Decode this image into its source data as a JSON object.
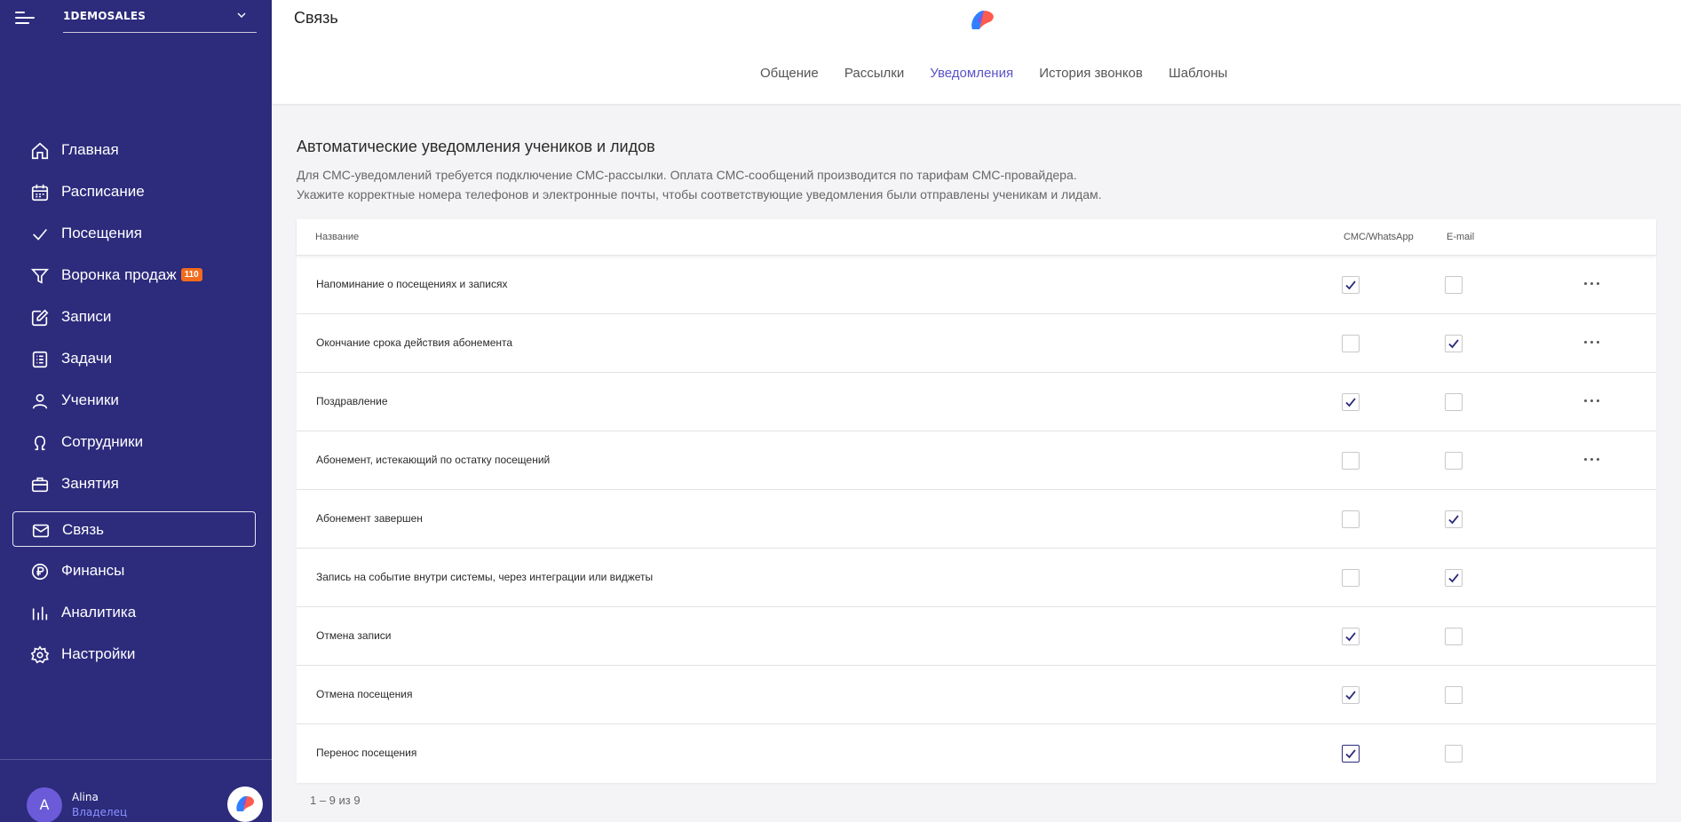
{
  "sidebar": {
    "org_name": "1DEMOSALES",
    "nav": [
      {
        "label": "Главная",
        "icon": "home-icon"
      },
      {
        "label": "Расписание",
        "icon": "calendar-icon"
      },
      {
        "label": "Посещения",
        "icon": "check-icon"
      },
      {
        "label": "Воронка продаж",
        "icon": "funnel-icon",
        "badge": "110"
      },
      {
        "label": "Записи",
        "icon": "edit-icon"
      },
      {
        "label": "Задачи",
        "icon": "tasks-icon"
      },
      {
        "label": "Ученики",
        "icon": "user-icon"
      },
      {
        "label": "Сотрудники",
        "icon": "staff-icon"
      },
      {
        "label": "Занятия",
        "icon": "briefcase-icon"
      },
      {
        "label": "Связь",
        "icon": "mail-icon",
        "active": true
      },
      {
        "label": "Финансы",
        "icon": "ruble-icon"
      },
      {
        "label": "Аналитика",
        "icon": "analytics-icon"
      },
      {
        "label": "Настройки",
        "icon": "settings-icon"
      }
    ],
    "user": {
      "initial": "A",
      "name": "Alina",
      "role": "Владелец"
    }
  },
  "header": {
    "title": "Связь",
    "tabs": [
      {
        "label": "Общение",
        "active": false
      },
      {
        "label": "Рассылки",
        "active": false
      },
      {
        "label": "Уведомления",
        "active": true
      },
      {
        "label": "История звонков",
        "active": false
      },
      {
        "label": "Шаблоны",
        "active": false
      }
    ]
  },
  "section": {
    "title": "Автоматические уведомления учеников и лидов",
    "desc_line1": "Для СМС-уведомлений требуется подключение СМС-рассылки. Оплата СМС-сообщений производится по тарифам СМС-провайдера.",
    "desc_line2": "Укажите корректные номера телефонов и электронные почты, чтобы соответствующие уведомления были отправлены ученикам и лидам."
  },
  "table": {
    "columns": {
      "name": "Название",
      "sms": "СМС/WhatsApp",
      "email": "E-mail"
    },
    "rows": [
      {
        "name": "Напоминание о посещениях и записях",
        "sms": true,
        "email": false,
        "menu": true
      },
      {
        "name": "Окончание срока действия абонемента",
        "sms": false,
        "email": true,
        "menu": true
      },
      {
        "name": "Поздравление",
        "sms": true,
        "email": false,
        "menu": true
      },
      {
        "name": "Абонемент, истекающий по остатку посещений",
        "sms": false,
        "email": false,
        "menu": true
      },
      {
        "name": "Абонемент завершен",
        "sms": false,
        "email": true,
        "menu": false
      },
      {
        "name": "Запись на событие внутри системы, через интеграции или виджеты",
        "sms": false,
        "email": true,
        "menu": false
      },
      {
        "name": "Отмена записи",
        "sms": true,
        "email": false,
        "menu": false
      },
      {
        "name": "Отмена посещения",
        "sms": true,
        "email": false,
        "menu": false
      },
      {
        "name": "Перенос посещения",
        "sms": true,
        "email": false,
        "menu": false,
        "focused": true
      }
    ]
  },
  "pagination": "1 – 9 из 9",
  "colors": {
    "sidebar": "#2c2b7c",
    "accent": "#5b52c8",
    "badge": "#f26b1d"
  }
}
